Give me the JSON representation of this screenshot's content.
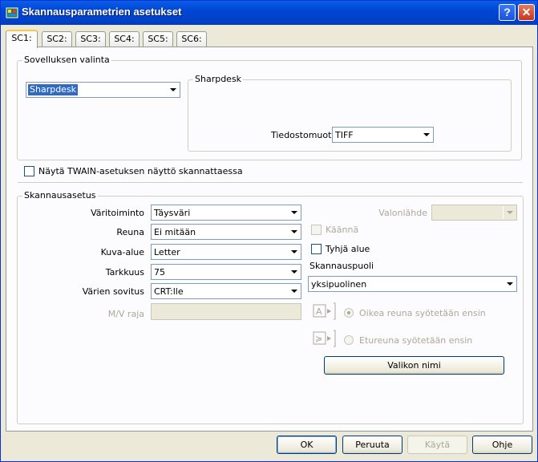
{
  "window": {
    "title": "Skannausparametrien asetukset"
  },
  "tabs": [
    "SC1:",
    "SC2:",
    "SC3:",
    "SC4:",
    "SC5:",
    "SC6:"
  ],
  "app_select": {
    "group_label": "Sovelluksen valinta",
    "application": "Sharpdesk",
    "sub_group_label": "Sharpdesk",
    "file_format_label": "Tiedostomuoto",
    "file_format": "TIFF"
  },
  "twain_checkbox_label": "Näytä TWAIN-asetuksen näyttö skannattaessa",
  "scan_settings": {
    "group_label": "Skannausasetus",
    "color_mode_label": "Väritoiminto",
    "color_mode": "Täysväri",
    "edge_label": "Reuna",
    "edge": "Ei mitään",
    "image_area_label": "Kuva-alue",
    "image_area": "Letter",
    "resolution_label": "Tarkkuus",
    "resolution": "75",
    "color_matching_label": "Värien sovitus",
    "color_matching": "CRT:lle",
    "bw_threshold_label": "M/V raja",
    "light_source_label": "Valonlähde",
    "rotate_label": "Käännä",
    "blank_area_label": "Tyhjä alue",
    "scan_side_label": "Skannauspuoli",
    "scan_side": "yksipuolinen",
    "radio_right_edge": "Oikea reuna syötetään ensin",
    "radio_top_edge": "Etureuna syötetään ensin",
    "menu_name_button": "Valikon nimi"
  },
  "buttons": {
    "ok": "OK",
    "cancel": "Peruuta",
    "apply": "Käytä",
    "help": "Ohje"
  }
}
